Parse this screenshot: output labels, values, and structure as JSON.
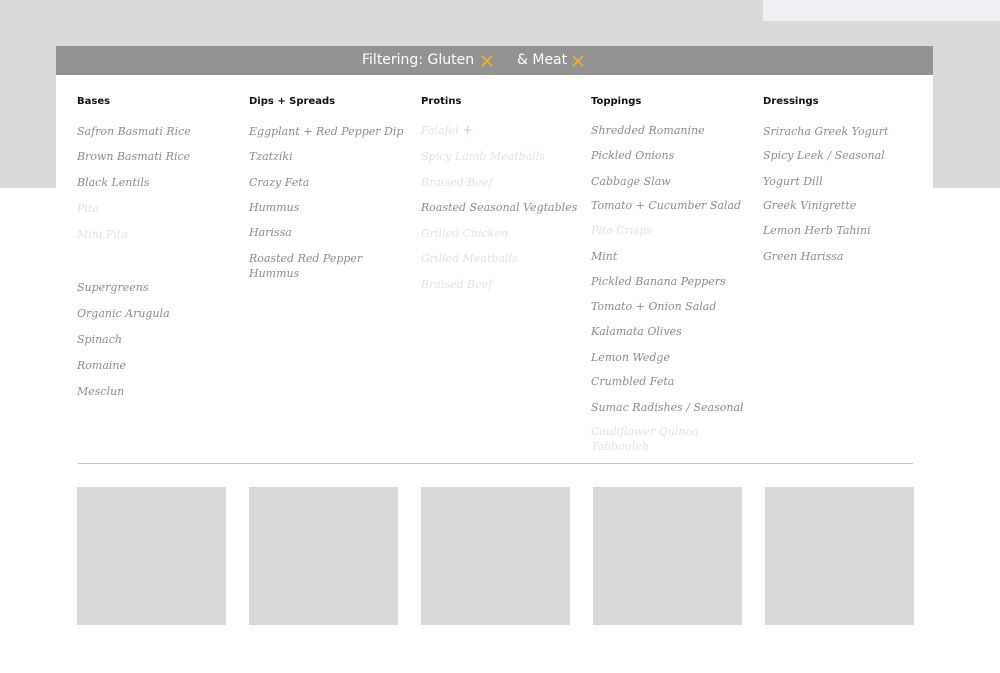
{
  "filter": {
    "prefix": "Filtering: Gluten",
    "second": "& Meat",
    "accent_color": "#f2b01e",
    "remove_icon": "close-x-icon"
  },
  "columns": [
    {
      "heading": "Bases",
      "items": [
        {
          "label": "Safron Basmati Rice",
          "dim": false
        },
        {
          "label": "Brown Basmati Rice",
          "dim": false
        },
        {
          "label": "Black Lentils",
          "dim": false
        },
        {
          "label": "Pita",
          "dim": true
        },
        {
          "label": "Mini Pita",
          "dim": true
        },
        {
          "label": "Supergreens",
          "dim": false
        },
        {
          "label": "Organic Arugula",
          "dim": false
        },
        {
          "label": "Spinach",
          "dim": false
        },
        {
          "label": "Romaine",
          "dim": false
        },
        {
          "label": "Mesclun",
          "dim": false
        }
      ]
    },
    {
      "heading": "Dips + Spreads",
      "items": [
        {
          "label": "Eggplant + Red Pepper Dip",
          "dim": false
        },
        {
          "label": "Tzatziki",
          "dim": false
        },
        {
          "label": "Crazy Feta",
          "dim": false
        },
        {
          "label": "Hummus",
          "dim": false
        },
        {
          "label": "Harissa",
          "dim": false
        },
        {
          "label": " Roasted Red Pepper Hummus",
          "dim": false
        }
      ]
    },
    {
      "heading": "Protins",
      "items": [
        {
          "label": "Falafel",
          "dim": true,
          "plus": "+"
        },
        {
          "label": "Spicy Lamb Meatballs",
          "dim": true
        },
        {
          "label": "Braised Beef",
          "dim": true
        },
        {
          "label": "Roasted Seasonal Vegtables",
          "dim": false
        },
        {
          "label": "Grilled Chicken",
          "dim": true
        },
        {
          "label": "Grilled Meatballs",
          "dim": true
        },
        {
          "label": "Braised Beef",
          "dim": true
        }
      ]
    },
    {
      "heading": "Toppings",
      "items": [
        {
          "label": "Shredded Romanine",
          "dim": false
        },
        {
          "label": "Pickled Onions",
          "dim": false
        },
        {
          "label": "Cabbage Slaw",
          "dim": false
        },
        {
          "label": "Tomato + Cucumber Salad",
          "dim": false
        },
        {
          "label": "Pita Crisps",
          "dim": true
        },
        {
          "label": "Mint",
          "dim": false
        },
        {
          "label": "Pickled Banana Peppers",
          "dim": false
        },
        {
          "label": "Tomato + Onion Salad",
          "dim": false
        },
        {
          "label": "Kalamata Olives",
          "dim": false
        },
        {
          "label": "Lemon Wedge",
          "dim": false
        },
        {
          "label": "Crumbled Feta",
          "dim": false
        },
        {
          "label": "Sumac Radishes / Seasonal",
          "dim": false
        },
        {
          "label": "Cauliflower Quinoa Tabbouleh",
          "dim": true
        }
      ]
    },
    {
      "heading": "Dressings",
      "items": [
        {
          "label": "Sriracha Greek Yogurt",
          "dim": false
        },
        {
          "label": "Spicy Leek / Seasonal",
          "dim": false
        },
        {
          "label": "Yogurt Dill",
          "dim": false
        },
        {
          "label": "Greek Vinigrette",
          "dim": false
        },
        {
          "label": "Lemon Herb Tahini",
          "dim": false
        },
        {
          "label": "Green Harissa",
          "dim": false
        }
      ]
    }
  ]
}
